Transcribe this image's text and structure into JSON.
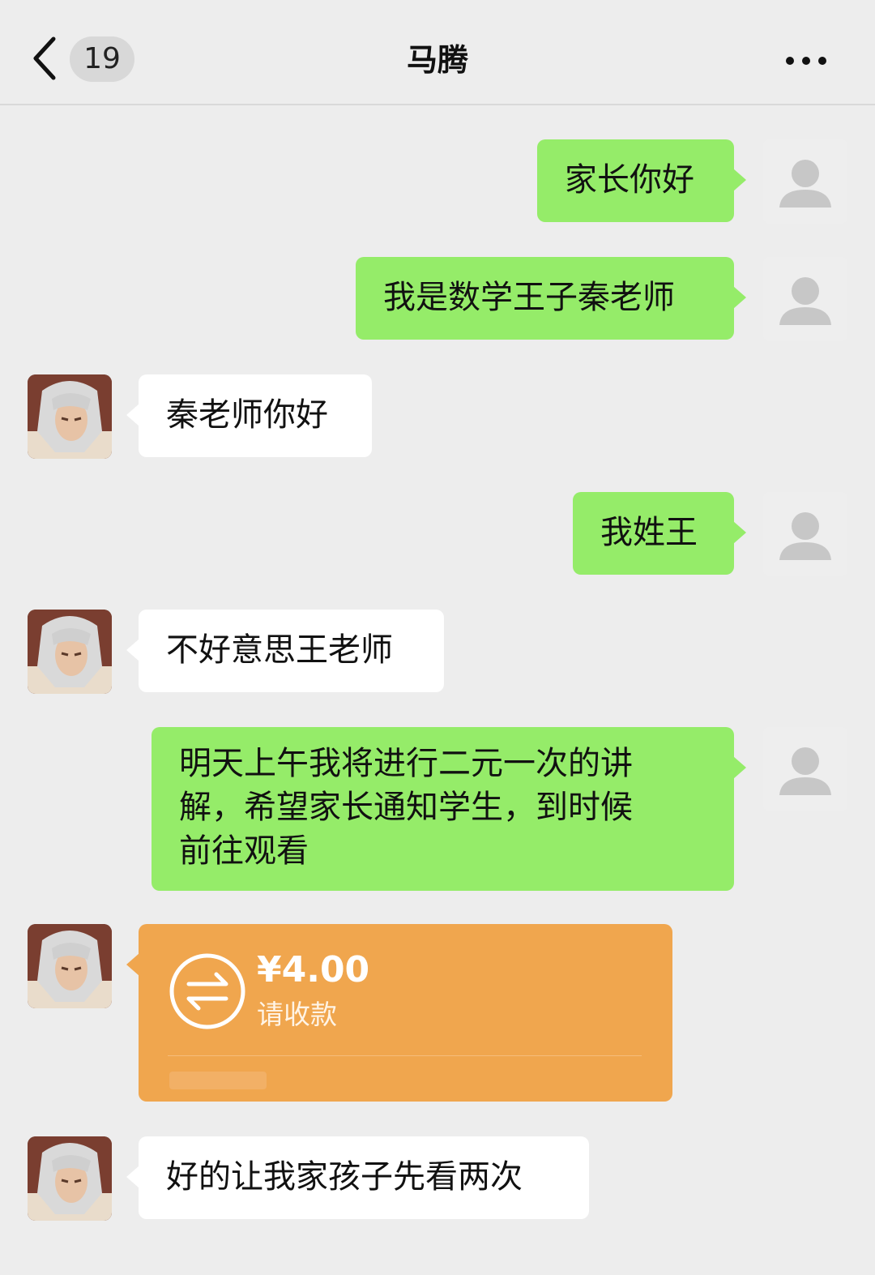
{
  "header": {
    "back_icon": "chevron-left-icon",
    "unread_count": "19",
    "title": "马腾",
    "more_icon": "more-dots-icon"
  },
  "messages": [
    {
      "sender": "me",
      "text": "家长你好"
    },
    {
      "sender": "me",
      "text": "我是数学王子秦老师"
    },
    {
      "sender": "other",
      "text": "秦老师你好"
    },
    {
      "sender": "me",
      "text": "我姓王"
    },
    {
      "sender": "other",
      "text": "不好意思王老师"
    },
    {
      "sender": "me",
      "text": "明天上午我将进行二元一次的讲\n解，希望家长通知学生，到时候\n前往观看"
    },
    {
      "sender": "other",
      "type": "transfer",
      "amount": "¥4.00",
      "status": "请收款",
      "icon": "transfer-arrows-icon"
    },
    {
      "sender": "other",
      "text": "好的让我家孩子先看两次"
    }
  ],
  "colors": {
    "background": "#ededed",
    "my_bubble": "#95ec69",
    "their_bubble": "#ffffff",
    "transfer_card": "#f0a64e"
  }
}
